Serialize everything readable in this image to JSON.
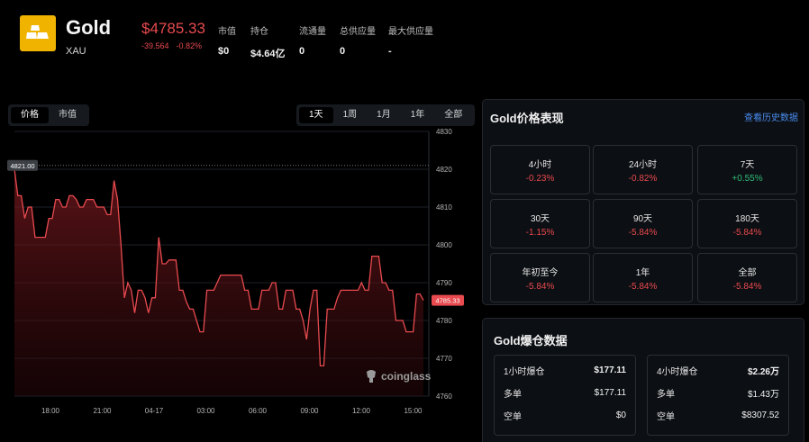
{
  "asset": {
    "name": "Gold",
    "symbol": "XAU",
    "price": "$4785.33",
    "change_abs": "-39.564",
    "change_pct": "-0.82%",
    "logo_color": "#f0b400"
  },
  "stats": [
    {
      "label": "市值",
      "value": "$0"
    },
    {
      "label": "持仓",
      "value": "$4.64亿"
    },
    {
      "label": "流通量",
      "value": "0"
    },
    {
      "label": "总供应量",
      "value": "0"
    },
    {
      "label": "最大供应量",
      "value": "-"
    }
  ],
  "chart_toggle": {
    "items": [
      "价格",
      "市值"
    ],
    "active": "价格"
  },
  "range_tabs": {
    "items": [
      "1天",
      "1周",
      "1月",
      "1年",
      "全部"
    ],
    "active": "1天"
  },
  "watermark": "coinglass",
  "chart_data": {
    "type": "line",
    "x_ticks": [
      "18:00",
      "21:00",
      "04-17",
      "03:00",
      "06:00",
      "09:00",
      "12:00",
      "15:00"
    ],
    "y_ticks": [
      4830,
      4820,
      4810,
      4800,
      4790,
      4780,
      4770,
      4760
    ],
    "ylim": [
      4760,
      4830
    ],
    "high_label": "4821.00",
    "last_label": "4785.33",
    "line_color": "#e84a4f",
    "series": [
      {
        "values": [
          4820,
          4813,
          4813,
          4807,
          4810,
          4810,
          4802,
          4802,
          4802,
          4802,
          4807,
          4807,
          4812,
          4812,
          4810,
          4810,
          4813,
          4813,
          4812,
          4810,
          4810,
          4812,
          4812,
          4812,
          4810,
          4810,
          4810,
          4808,
          4808,
          4817,
          4812,
          4800,
          4786,
          4790,
          4788,
          4782,
          4788,
          4788,
          4786,
          4782,
          4786,
          4786,
          4802,
          4795,
          4795,
          4796,
          4796,
          4796,
          4788,
          4788,
          4785,
          4783,
          4783,
          4780,
          4777,
          4777,
          4788,
          4788,
          4788,
          4790,
          4792,
          4792,
          4792,
          4792,
          4792,
          4792,
          4792,
          4788,
          4788,
          4783,
          4783,
          4783,
          4788,
          4788,
          4788,
          4790,
          4790,
          4783,
          4783,
          4788,
          4788,
          4788,
          4783,
          4783,
          4780,
          4775,
          4783,
          4788,
          4788,
          4768,
          4768,
          4783,
          4783,
          4783,
          4786,
          4788,
          4788,
          4788,
          4788,
          4788,
          4788,
          4790,
          4788,
          4788,
          4797,
          4797,
          4797,
          4790,
          4790,
          4788,
          4788,
          4780,
          4780,
          4780,
          4777,
          4777,
          4777,
          4787,
          4787,
          4785.33
        ]
      }
    ]
  },
  "performance": {
    "title": "Gold价格表现",
    "link": "查看历史数据",
    "items": [
      {
        "label": "4小时",
        "value": "-0.23%",
        "dir": "neg"
      },
      {
        "label": "24小时",
        "value": "-0.82%",
        "dir": "neg"
      },
      {
        "label": "7天",
        "value": "+0.55%",
        "dir": "pos"
      },
      {
        "label": "30天",
        "value": "-1.15%",
        "dir": "neg"
      },
      {
        "label": "90天",
        "value": "-5.84%",
        "dir": "neg"
      },
      {
        "label": "180天",
        "value": "-5.84%",
        "dir": "neg"
      },
      {
        "label": "年初至今",
        "value": "-5.84%",
        "dir": "neg"
      },
      {
        "label": "1年",
        "value": "-5.84%",
        "dir": "neg"
      },
      {
        "label": "全部",
        "value": "-5.84%",
        "dir": "neg"
      }
    ]
  },
  "liquidation": {
    "title": "Gold爆仓数据",
    "boxes": [
      {
        "rows": [
          {
            "label": "1小时爆仓",
            "value": "$177.11",
            "dir": ""
          },
          {
            "label": "多单",
            "value": "$177.11",
            "dir": "pos"
          },
          {
            "label": "空单",
            "value": "$0",
            "dir": "neg"
          }
        ]
      },
      {
        "rows": [
          {
            "label": "4小时爆仓",
            "value": "$2.26万",
            "dir": ""
          },
          {
            "label": "多单",
            "value": "$1.43万",
            "dir": "pos"
          },
          {
            "label": "空单",
            "value": "$8307.52",
            "dir": "neg"
          }
        ]
      }
    ]
  }
}
